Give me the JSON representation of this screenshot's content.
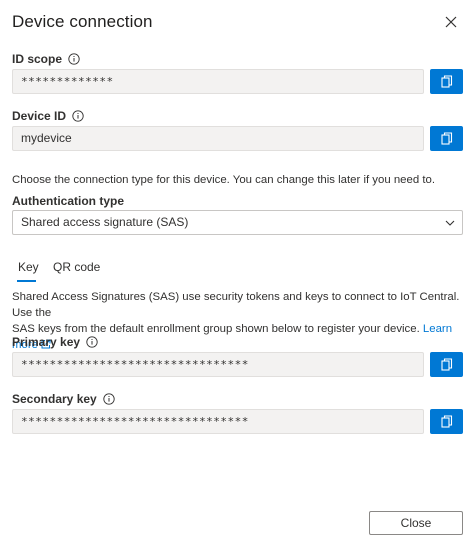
{
  "dialog": {
    "title": "Device connection",
    "close_icon": "close-icon"
  },
  "id_scope": {
    "label": "ID scope",
    "value": "*************",
    "info_icon": "info-icon",
    "copy_icon": "copy-icon"
  },
  "device_id": {
    "label": "Device ID",
    "value": "mydevice",
    "info_icon": "info-icon",
    "copy_icon": "copy-icon"
  },
  "connection_help": "Choose the connection type for this device. You can change this later if you need to.",
  "auth_type": {
    "label": "Authentication type",
    "selected": "Shared access signature (SAS)",
    "chevron_icon": "chevron-down-icon"
  },
  "tabs": [
    {
      "label": "Key",
      "active": true
    },
    {
      "label": "QR code",
      "active": false
    }
  ],
  "sas_description": {
    "line1": "Shared Access Signatures (SAS) use security tokens and keys to connect to IoT Central. Use the",
    "line2": "SAS keys from the default enrollment group shown below to register your device.",
    "link": "Learn more",
    "link_icon": "external-link-icon"
  },
  "primary_key": {
    "label": "Primary key",
    "value": "********************************",
    "info_icon": "info-icon",
    "copy_icon": "copy-icon"
  },
  "secondary_key": {
    "label": "Secondary key",
    "value": "********************************",
    "info_icon": "info-icon",
    "copy_icon": "copy-icon"
  },
  "footer": {
    "close_label": "Close"
  },
  "colors": {
    "accent": "#0078d4",
    "input_bg": "#f3f2f1",
    "text": "#323130"
  }
}
